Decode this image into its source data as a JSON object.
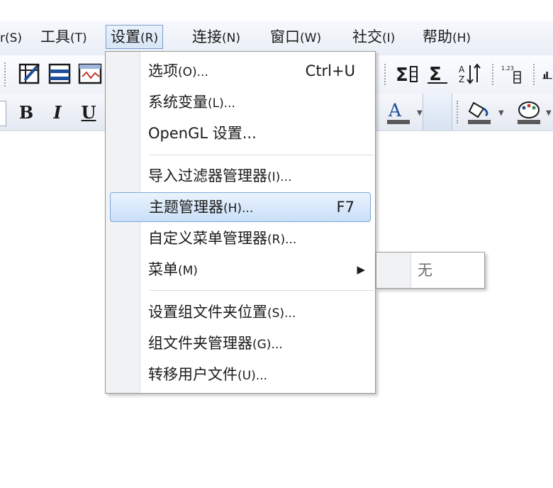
{
  "menubar": {
    "items": [
      {
        "label": "",
        "mnemonic": "r(S)"
      },
      {
        "label": "工具",
        "mnemonic": "(T)"
      },
      {
        "label": "设置",
        "mnemonic": "(R)"
      },
      {
        "label": "连接",
        "mnemonic": "(N)"
      },
      {
        "label": "窗口",
        "mnemonic": "(W)"
      },
      {
        "label": "社交",
        "mnemonic": "(I)"
      },
      {
        "label": "帮助",
        "mnemonic": "(H)"
      }
    ]
  },
  "toolbar1": {
    "icons": [
      "edit-grid-icon",
      "rows-icon",
      "sheet-edit-icon",
      "sum-icon",
      "stats-sum-icon",
      "sort-az-icon",
      "number-format-icon",
      "chart-icon"
    ]
  },
  "toolbar2": {
    "bold": "B",
    "italic": "I",
    "underline": "U",
    "font_color": "A",
    "icons": [
      "font-color-icon",
      "fill-color-icon",
      "palette-icon"
    ]
  },
  "dropdown": {
    "items": [
      {
        "label": "选项",
        "mnemonic": "(O)...",
        "shortcut": "Ctrl+U"
      },
      {
        "label": "系统变量",
        "mnemonic": "(L)...",
        "shortcut": ""
      },
      {
        "label": "OpenGL 设置...",
        "mnemonic": "",
        "shortcut": ""
      },
      {
        "label": "导入过滤器管理器",
        "mnemonic": "(I)...",
        "shortcut": ""
      },
      {
        "label": "主题管理器",
        "mnemonic": "(H)...",
        "shortcut": "F7"
      },
      {
        "label": "自定义菜单管理器",
        "mnemonic": "(R)...",
        "shortcut": ""
      },
      {
        "label": "菜单",
        "mnemonic": "(M)",
        "shortcut": ""
      },
      {
        "label": "设置组文件夹位置",
        "mnemonic": "(S)...",
        "shortcut": ""
      },
      {
        "label": "组文件夹管理器",
        "mnemonic": "(G)...",
        "shortcut": ""
      },
      {
        "label": "转移用户文件",
        "mnemonic": "(U)...",
        "shortcut": ""
      }
    ]
  },
  "submenu": {
    "items": [
      {
        "label": "无"
      }
    ]
  },
  "colors": {
    "highlight_border": "#7da7d9",
    "highlight_fill": "#c9dff7",
    "menubar_open_border": "#7a9cc8",
    "font_color_red": "#c0392b",
    "icon_blue": "#1f4e9a"
  }
}
